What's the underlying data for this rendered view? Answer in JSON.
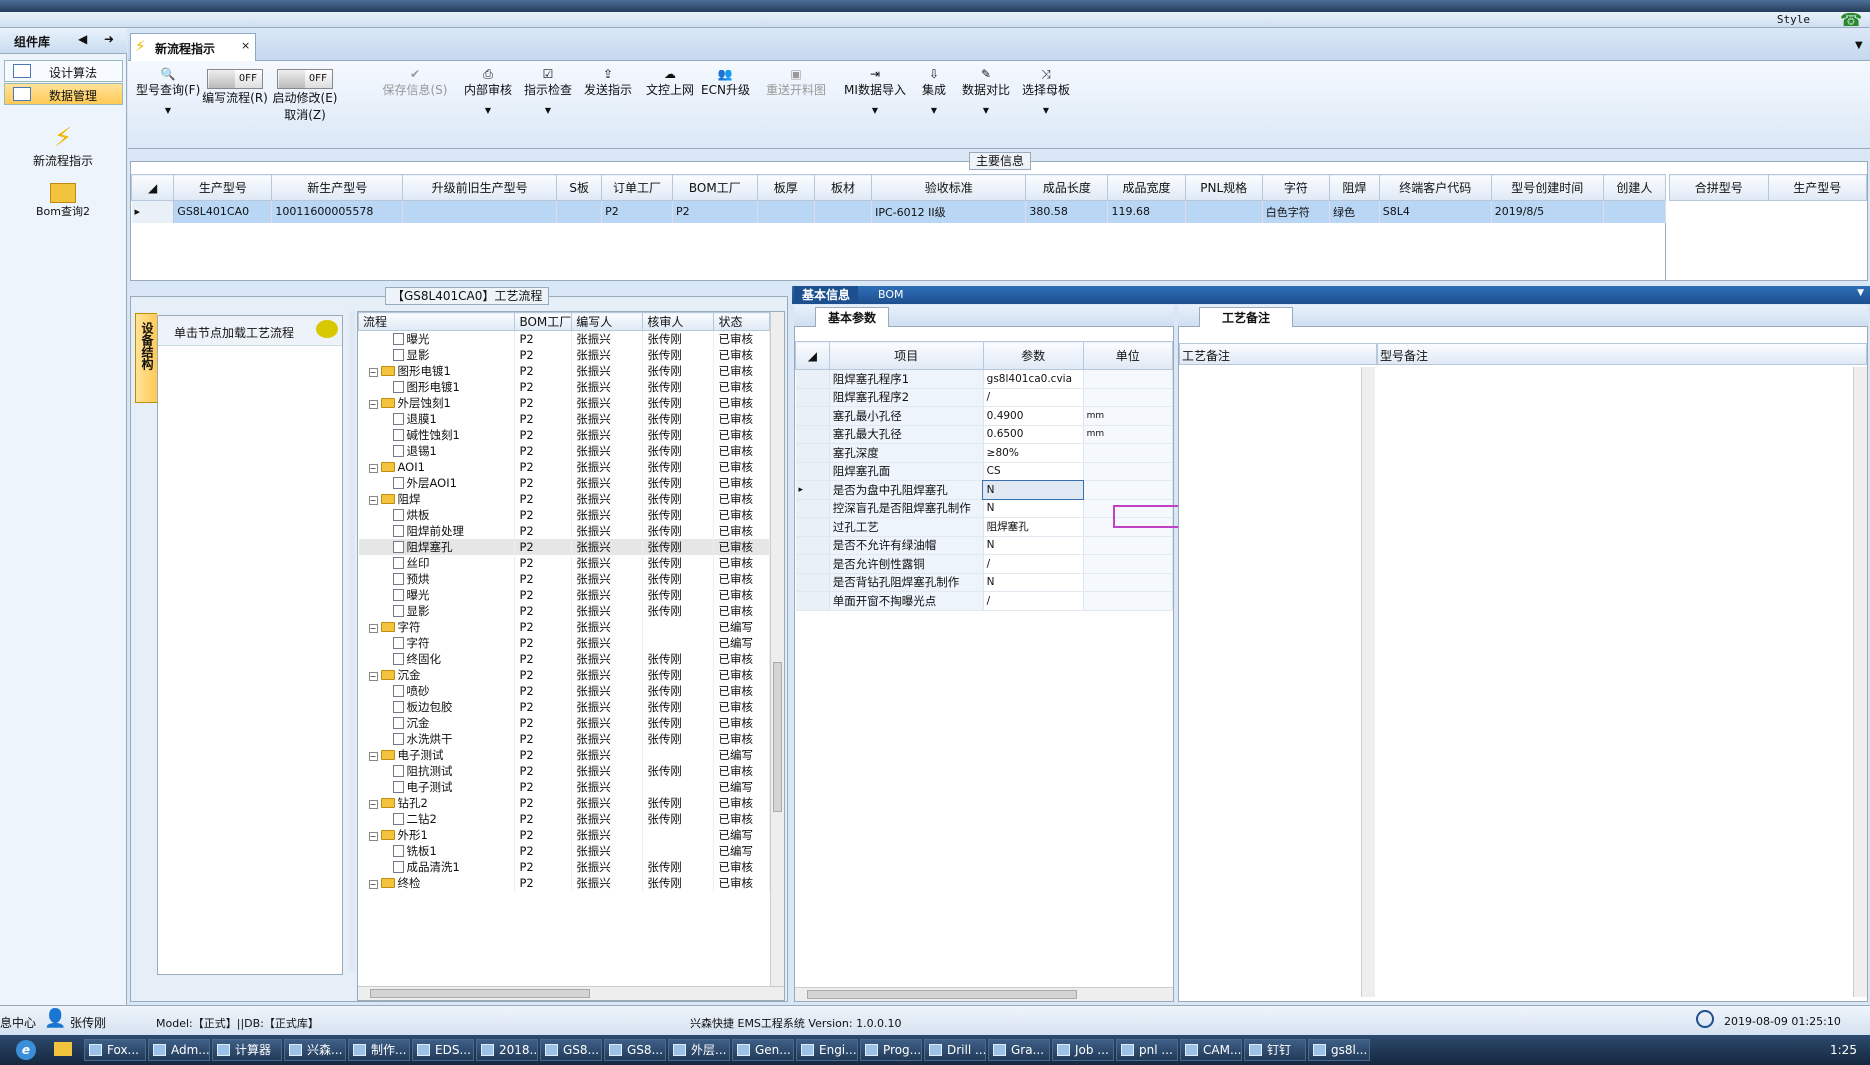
{
  "window": {
    "style_label": "Style"
  },
  "left_panel": {
    "title": "组件库",
    "items": [
      "设计算法",
      "数据管理"
    ],
    "modules": [
      "新流程指示",
      "Bom查询2"
    ]
  },
  "doc_tab": {
    "title": "新流程指示"
  },
  "ribbon": {
    "buttons": [
      {
        "label": "型号查询(F)",
        "icon": "search-icon"
      },
      {
        "label": "编写流程(R)",
        "toggle": "OFF"
      },
      {
        "label": "启动修改(E)",
        "toggle": "OFF",
        "sub": "取消(Z)"
      },
      {
        "label": "保存信息(S)",
        "icon": "check-icon",
        "disabled": true
      },
      {
        "label": "内部审核",
        "icon": "printer-icon"
      },
      {
        "label": "指示检查",
        "icon": "checkbox-icon"
      },
      {
        "label": "发送指示",
        "icon": "upload-icon"
      },
      {
        "label": "文控上网",
        "icon": "cloud-upload-icon"
      },
      {
        "label": "ECN升级",
        "icon": "users-icon"
      },
      {
        "label": "重送开料图",
        "icon": "image-icon",
        "disabled": true
      },
      {
        "label": "MI数据导入",
        "icon": "import-icon"
      },
      {
        "label": "集成",
        "icon": "download-icon"
      },
      {
        "label": "数据对比",
        "icon": "wand-icon"
      },
      {
        "label": "选择母板",
        "icon": "shuffle-icon"
      }
    ]
  },
  "main_info": {
    "title": "主要信息",
    "columns": [
      "生产型号",
      "新生产型号",
      "升级前旧生产型号",
      "S板",
      "订单工厂",
      "BOM工厂",
      "板厚",
      "板材",
      "验收标准",
      "成品长度",
      "成品宽度",
      "PNL规格",
      "字符",
      "阻焊",
      "终端客户代码",
      "型号创建时间",
      "创建人"
    ],
    "row": [
      "GS8L401CA0",
      "10011600005578",
      "",
      "",
      "P2",
      "P2",
      "",
      "",
      "IPC-6012 II级",
      "380.58",
      "119.68",
      "",
      "白色字符",
      "绿色",
      "S8L4",
      "2019/8/5",
      ""
    ],
    "side_columns": [
      "合拼型号",
      "生产型号"
    ]
  },
  "process": {
    "title": "【GS8L401CA0】工艺流程",
    "vertical_tab": "设备结构",
    "hint": "单击节点加载工艺流程",
    "columns": [
      "流程",
      "BOM工厂",
      "编写人",
      "核审人",
      "状态"
    ],
    "rows": [
      {
        "name": "曝光",
        "level": 2,
        "type": "leaf",
        "bom": "P2",
        "author": "张振兴",
        "reviewer": "张传刚",
        "status": "已审核"
      },
      {
        "name": "显影",
        "level": 2,
        "type": "leaf",
        "bom": "P2",
        "author": "张振兴",
        "reviewer": "张传刚",
        "status": "已审核"
      },
      {
        "name": "图形电镀1",
        "level": 1,
        "type": "folder",
        "bom": "P2",
        "author": "张振兴",
        "reviewer": "张传刚",
        "status": "已审核"
      },
      {
        "name": "图形电镀1",
        "level": 2,
        "type": "leaf",
        "bom": "P2",
        "author": "张振兴",
        "reviewer": "张传刚",
        "status": "已审核"
      },
      {
        "name": "外层蚀刻1",
        "level": 1,
        "type": "folder",
        "bom": "P2",
        "author": "张振兴",
        "reviewer": "张传刚",
        "status": "已审核"
      },
      {
        "name": "退膜1",
        "level": 2,
        "type": "leaf",
        "bom": "P2",
        "author": "张振兴",
        "reviewer": "张传刚",
        "status": "已审核"
      },
      {
        "name": "碱性蚀刻1",
        "level": 2,
        "type": "leaf",
        "bom": "P2",
        "author": "张振兴",
        "reviewer": "张传刚",
        "status": "已审核"
      },
      {
        "name": "退锡1",
        "level": 2,
        "type": "leaf",
        "bom": "P2",
        "author": "张振兴",
        "reviewer": "张传刚",
        "status": "已审核"
      },
      {
        "name": "AOI1",
        "level": 1,
        "type": "folder",
        "bom": "P2",
        "author": "张振兴",
        "reviewer": "张传刚",
        "status": "已审核"
      },
      {
        "name": "外层AOI1",
        "level": 2,
        "type": "leaf",
        "bom": "P2",
        "author": "张振兴",
        "reviewer": "张传刚",
        "status": "已审核"
      },
      {
        "name": "阻焊",
        "level": 1,
        "type": "folder",
        "bom": "P2",
        "author": "张振兴",
        "reviewer": "张传刚",
        "status": "已审核"
      },
      {
        "name": "烘板",
        "level": 2,
        "type": "leaf",
        "bom": "P2",
        "author": "张振兴",
        "reviewer": "张传刚",
        "status": "已审核"
      },
      {
        "name": "阻焊前处理",
        "level": 2,
        "type": "leaf",
        "bom": "P2",
        "author": "张振兴",
        "reviewer": "张传刚",
        "status": "已审核"
      },
      {
        "name": "阻焊塞孔",
        "level": 2,
        "type": "leaf",
        "bom": "P2",
        "author": "张振兴",
        "reviewer": "张传刚",
        "status": "已审核",
        "selected": true
      },
      {
        "name": "丝印",
        "level": 2,
        "type": "leaf",
        "bom": "P2",
        "author": "张振兴",
        "reviewer": "张传刚",
        "status": "已审核"
      },
      {
        "name": "预烘",
        "level": 2,
        "type": "leaf",
        "bom": "P2",
        "author": "张振兴",
        "reviewer": "张传刚",
        "status": "已审核"
      },
      {
        "name": "曝光",
        "level": 2,
        "type": "leaf",
        "bom": "P2",
        "author": "张振兴",
        "reviewer": "张传刚",
        "status": "已审核"
      },
      {
        "name": "显影",
        "level": 2,
        "type": "leaf",
        "bom": "P2",
        "author": "张振兴",
        "reviewer": "张传刚",
        "status": "已审核"
      },
      {
        "name": "字符",
        "level": 1,
        "type": "folder",
        "bom": "P2",
        "author": "张振兴",
        "reviewer": "",
        "status": "已编写"
      },
      {
        "name": "字符",
        "level": 2,
        "type": "leaf",
        "bom": "P2",
        "author": "张振兴",
        "reviewer": "",
        "status": "已编写"
      },
      {
        "name": "终固化",
        "level": 2,
        "type": "leaf",
        "bom": "P2",
        "author": "张振兴",
        "reviewer": "张传刚",
        "status": "已审核"
      },
      {
        "name": "沉金",
        "level": 1,
        "type": "folder",
        "bom": "P2",
        "author": "张振兴",
        "reviewer": "张传刚",
        "status": "已审核"
      },
      {
        "name": "喷砂",
        "level": 2,
        "type": "leaf",
        "bom": "P2",
        "author": "张振兴",
        "reviewer": "张传刚",
        "status": "已审核"
      },
      {
        "name": "板边包胶",
        "level": 2,
        "type": "leaf",
        "bom": "P2",
        "author": "张振兴",
        "reviewer": "张传刚",
        "status": "已审核"
      },
      {
        "name": "沉金",
        "level": 2,
        "type": "leaf",
        "bom": "P2",
        "author": "张振兴",
        "reviewer": "张传刚",
        "status": "已审核"
      },
      {
        "name": "水洗烘干",
        "level": 2,
        "type": "leaf",
        "bom": "P2",
        "author": "张振兴",
        "reviewer": "张传刚",
        "status": "已审核"
      },
      {
        "name": "电子测试",
        "level": 1,
        "type": "folder",
        "bom": "P2",
        "author": "张振兴",
        "reviewer": "",
        "status": "已编写"
      },
      {
        "name": "阻抗测试",
        "level": 2,
        "type": "leaf",
        "bom": "P2",
        "author": "张振兴",
        "reviewer": "张传刚",
        "status": "已审核"
      },
      {
        "name": "电子测试",
        "level": 2,
        "type": "leaf",
        "bom": "P2",
        "author": "张振兴",
        "reviewer": "",
        "status": "已编写"
      },
      {
        "name": "钻孔2",
        "level": 1,
        "type": "folder",
        "bom": "P2",
        "author": "张振兴",
        "reviewer": "张传刚",
        "status": "已审核"
      },
      {
        "name": "二钻2",
        "level": 2,
        "type": "leaf",
        "bom": "P2",
        "author": "张振兴",
        "reviewer": "张传刚",
        "status": "已审核"
      },
      {
        "name": "外形1",
        "level": 1,
        "type": "folder",
        "bom": "P2",
        "author": "张振兴",
        "reviewer": "",
        "status": "已编写"
      },
      {
        "name": "铣板1",
        "level": 2,
        "type": "leaf",
        "bom": "P2",
        "author": "张振兴",
        "reviewer": "",
        "status": "已编写"
      },
      {
        "name": "成品清洗1",
        "level": 2,
        "type": "leaf",
        "bom": "P2",
        "author": "张振兴",
        "reviewer": "张传刚",
        "status": "已审核"
      },
      {
        "name": "终检",
        "level": 1,
        "type": "folder",
        "bom": "P2",
        "author": "张振兴",
        "reviewer": "张传刚",
        "status": "已审核"
      }
    ]
  },
  "detail": {
    "tabs": [
      "基本信息",
      "BOM"
    ],
    "subtab": "基本参数",
    "columns": [
      "项目",
      "参数",
      "单位"
    ],
    "rows": [
      {
        "item": "阻焊塞孔程序1",
        "param": "gs8l401ca0.cvia",
        "unit": ""
      },
      {
        "item": "阻焊塞孔程序2",
        "param": "/",
        "unit": ""
      },
      {
        "item": "塞孔最小孔径",
        "param": "0.4900",
        "unit": "mm"
      },
      {
        "item": "塞孔最大孔径",
        "param": "0.6500",
        "unit": "mm"
      },
      {
        "item": "塞孔深度",
        "param": "≥80%",
        "unit": ""
      },
      {
        "item": "阻焊塞孔面",
        "param": "CS",
        "unit": ""
      },
      {
        "item": "是否为盘中孔阻焊塞孔",
        "param": "N",
        "unit": "",
        "selected": true
      },
      {
        "item": "控深盲孔是否阻焊塞孔制作",
        "param": "N",
        "unit": ""
      },
      {
        "item": "过孔工艺",
        "param": "阻焊塞孔",
        "unit": ""
      },
      {
        "item": "是否不允许有绿油帽",
        "param": "N",
        "unit": ""
      },
      {
        "item": "是否允许刨性露铜",
        "param": "/",
        "unit": ""
      },
      {
        "item": "是否背钻孔阻焊塞孔制作",
        "param": "N",
        "unit": ""
      },
      {
        "item": "单面开窗不掏曝光点",
        "param": "/",
        "unit": ""
      }
    ]
  },
  "remarks": {
    "tab": "工艺备注",
    "columns": [
      "工艺备注",
      "型号备注"
    ]
  },
  "status_bar": {
    "left": "息中心",
    "user": "张传刚",
    "model": "Model:【正式】||DB:【正式库】",
    "app": "兴森快捷 EMS工程系统 Version: 1.0.0.10",
    "datetime": "2019-08-09 01:25:10"
  },
  "taskbar": {
    "items": [
      "Fox...",
      "Adm...",
      "计算器",
      "兴森...",
      "制作...",
      "EDS...",
      "2018...",
      "GS8...",
      "GS8...",
      "外层...",
      "Gen...",
      "Engi...",
      "Prog...",
      "Drill ...",
      "Gra...",
      "Job ...",
      "pnl ...",
      "CAM...",
      "钉钉",
      "gs8l..."
    ],
    "time": "1:25"
  },
  "colors": {
    "accent": "#ffd87a",
    "selection": "#b9d6f5",
    "highlight_box": "#c040c8",
    "header_blue": "#2f6eb5"
  }
}
